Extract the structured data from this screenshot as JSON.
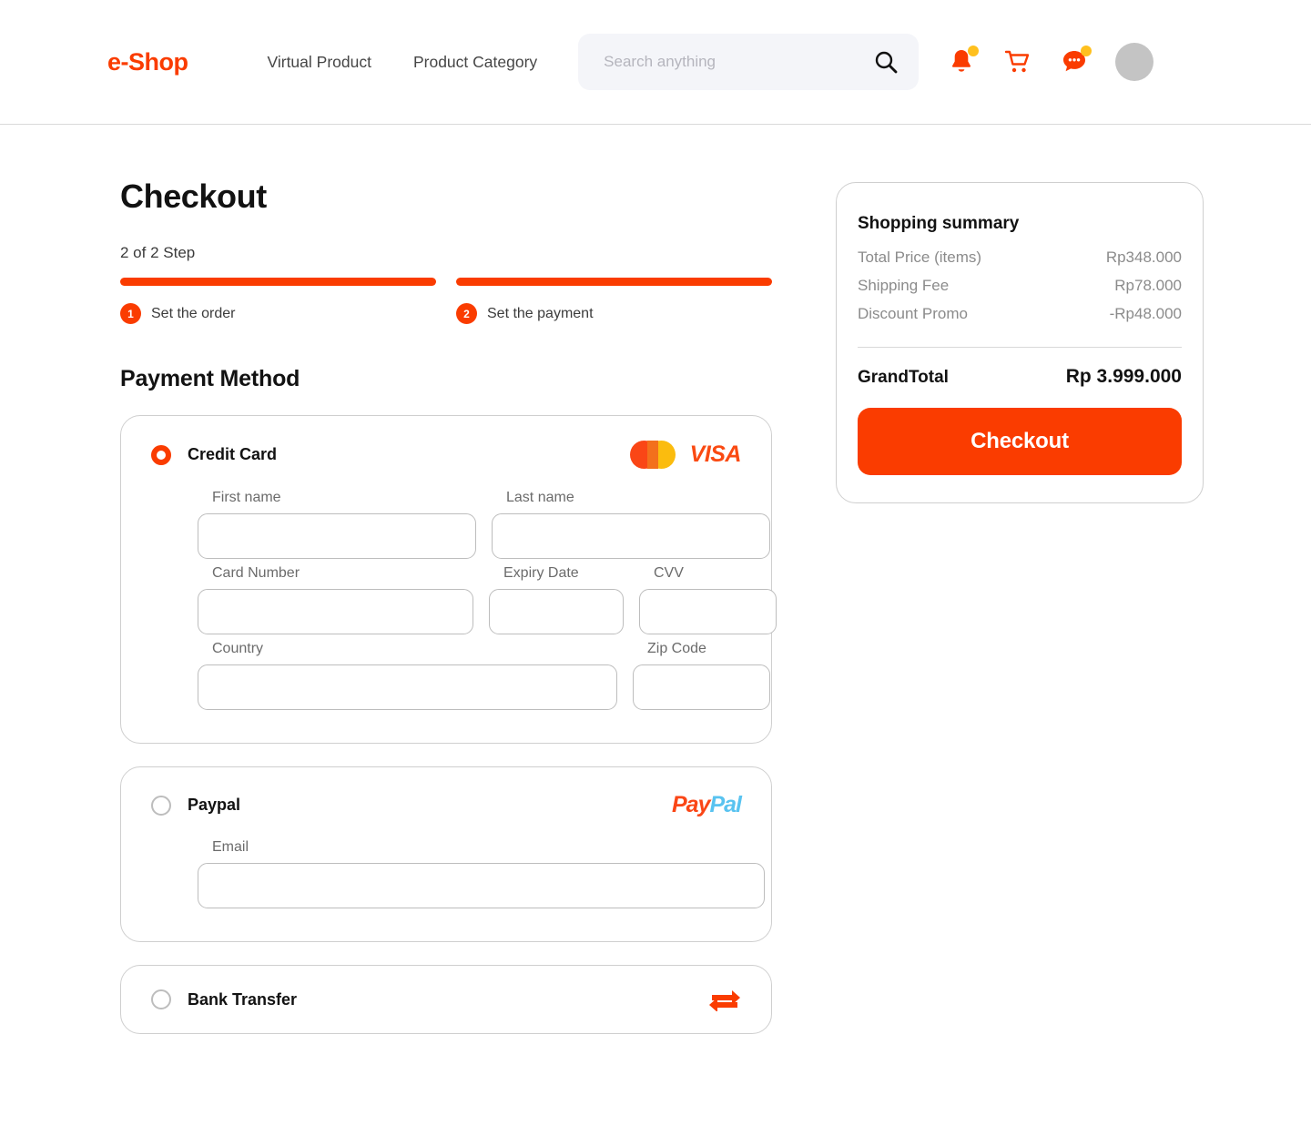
{
  "header": {
    "logo": "e-Shop",
    "nav": [
      {
        "label": "Virtual Product"
      },
      {
        "label": "Product Category"
      }
    ],
    "search": {
      "value": "",
      "placeholder": "Search anything"
    },
    "icons": [
      {
        "name": "notification-bell-icon",
        "badge": true
      },
      {
        "name": "shopping-cart-icon",
        "badge": false
      },
      {
        "name": "chat-bubble-icon",
        "badge": true
      }
    ],
    "avatar": "user-avatar"
  },
  "main": {
    "page_title": "Checkout",
    "steps_label": "2 of 2 Step",
    "steps": [
      {
        "number": "1",
        "label": "Set the order",
        "complete": true
      },
      {
        "number": "2",
        "label": "Set the payment",
        "complete": true
      }
    ],
    "payment_section_title": "Payment Method",
    "payment_methods": [
      {
        "id": "credit-card",
        "label": "Credit Card",
        "selected": true,
        "logos": [
          "mastercard",
          "visa"
        ],
        "visa_text": "VISA",
        "fields": [
          {
            "label": "First name",
            "value": "",
            "placeholder": ""
          },
          {
            "label": "Last name",
            "value": "",
            "placeholder": ""
          },
          {
            "label": "Card Number",
            "value": "",
            "placeholder": ""
          },
          {
            "label": "Expiry Date",
            "value": "",
            "placeholder": ""
          },
          {
            "label": "CVV",
            "value": "",
            "placeholder": ""
          },
          {
            "label": "Country",
            "value": "",
            "placeholder": ""
          },
          {
            "label": "Zip Code",
            "value": "",
            "placeholder": ""
          }
        ]
      },
      {
        "id": "paypal",
        "label": "Paypal",
        "selected": false,
        "logo_part1": "Pay",
        "logo_part2": "Pal",
        "fields": [
          {
            "label": "Email",
            "value": "",
            "placeholder": ""
          }
        ]
      },
      {
        "id": "bank-transfer",
        "label": "Bank Transfer",
        "selected": false,
        "icon": "transfer-arrows-icon"
      }
    ]
  },
  "summary": {
    "title": "Shopping summary",
    "rows": [
      {
        "label": "Total Price (items)",
        "value": "Rp348.000"
      },
      {
        "label": "Shipping Fee",
        "value": "Rp78.000"
      },
      {
        "label": "Discount Promo",
        "value": "-Rp48.000"
      }
    ],
    "grand_total_label": "GrandTotal",
    "grand_total_value": "Rp 3.999.000",
    "checkout_button": "Checkout"
  },
  "colors": {
    "brand_orange": "#fa3c00",
    "badge_yellow": "#ffc01e",
    "paypal_blue": "#59c3f0",
    "mastercard_red": "#fa4616",
    "mastercard_yellow": "#fbbc0e"
  }
}
